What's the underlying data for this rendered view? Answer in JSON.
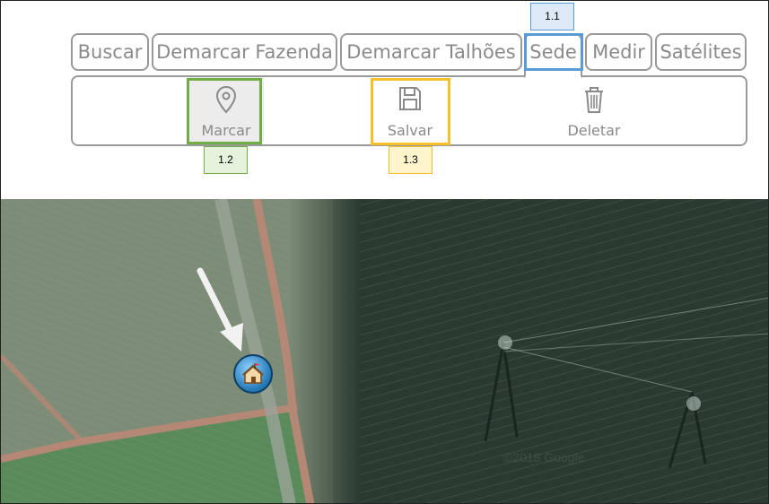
{
  "tabs": [
    {
      "id": "buscar",
      "label": "Buscar"
    },
    {
      "id": "demarcar-fazenda",
      "label": "Demarcar Fazenda"
    },
    {
      "id": "demarcar-talhoes",
      "label": "Demarcar Talhões"
    },
    {
      "id": "sede",
      "label": "Sede",
      "active": true
    },
    {
      "id": "medir",
      "label": "Medir"
    },
    {
      "id": "satelites",
      "label": "Satélites"
    }
  ],
  "tools": [
    {
      "id": "marcar",
      "label": "Marcar",
      "icon": "map-pin-icon"
    },
    {
      "id": "salvar",
      "label": "Salvar",
      "icon": "floppy-disk-icon"
    },
    {
      "id": "deletar",
      "label": "Deletar",
      "icon": "trash-icon"
    }
  ],
  "callouts": [
    {
      "id": "1.1",
      "label": "1.1",
      "color": "#5b9bd5",
      "fill": "#dde9f6"
    },
    {
      "id": "1.2",
      "label": "1.2",
      "color": "#70ad47",
      "fill": "#e6f2dc"
    },
    {
      "id": "1.3",
      "label": "1.3",
      "color": "#f5c02a",
      "fill": "#fff4cc"
    }
  ],
  "map": {
    "marker_icon": "house-flag-icon",
    "arrow_icon": "arrow-down-right-icon",
    "watermark": "©2018 Google"
  },
  "colors": {
    "tab_border": "#9a9a9a",
    "tab_text": "#8a8a8a",
    "field_light": "#7d8c77",
    "field_dark": "#2b3a30",
    "dirt_road": "#b48874"
  }
}
